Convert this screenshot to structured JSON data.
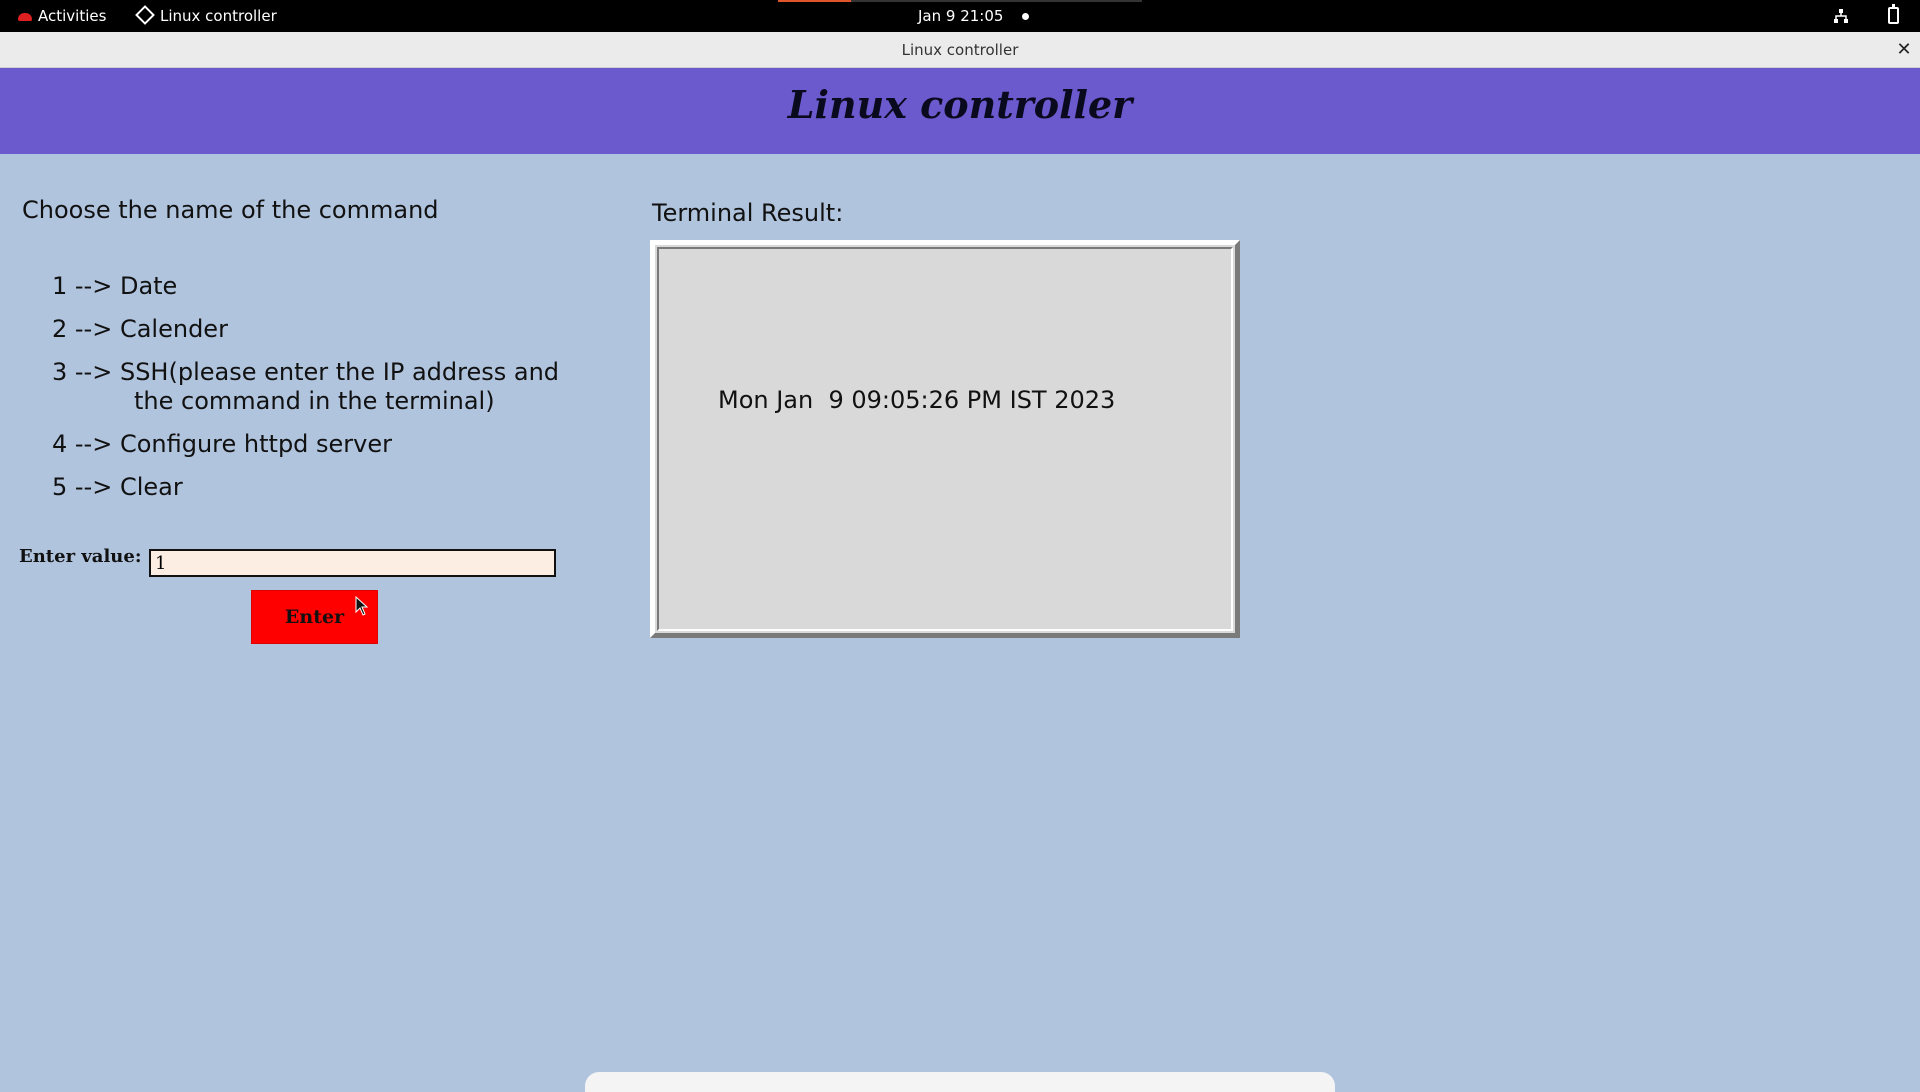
{
  "topbar": {
    "activities": "Activities",
    "app_name": "Linux controller",
    "clock": "Jan 9  21:05"
  },
  "window": {
    "title": "Linux controller",
    "close_symbol": "✕"
  },
  "banner": {
    "heading": "Linux controller"
  },
  "left_panel": {
    "prompt": "Choose the name of the command",
    "options": [
      "1 --> Date",
      "2 --> Calender",
      "3 --> SSH(please enter the IP address and",
      "the command in the terminal)",
      "4 --> Configure httpd server",
      "5 --> Clear"
    ],
    "input_label": "Enter value:",
    "input_value": "1",
    "button_label": "Enter"
  },
  "right_panel": {
    "label": "Terminal Result:",
    "output": "Mon Jan  9 09:05:26 PM IST 2023"
  },
  "colors": {
    "banner": "#6a5acd",
    "background": "#b0c4de",
    "button": "#ff0000",
    "input_bg": "#fdeee4",
    "terminal_bg": "#d9d9d9"
  },
  "icons": {
    "activities": "redhat-icon",
    "app_menu": "app-diamond-icon",
    "network": "network-wired-icon",
    "battery": "battery-icon",
    "close": "close-icon"
  }
}
